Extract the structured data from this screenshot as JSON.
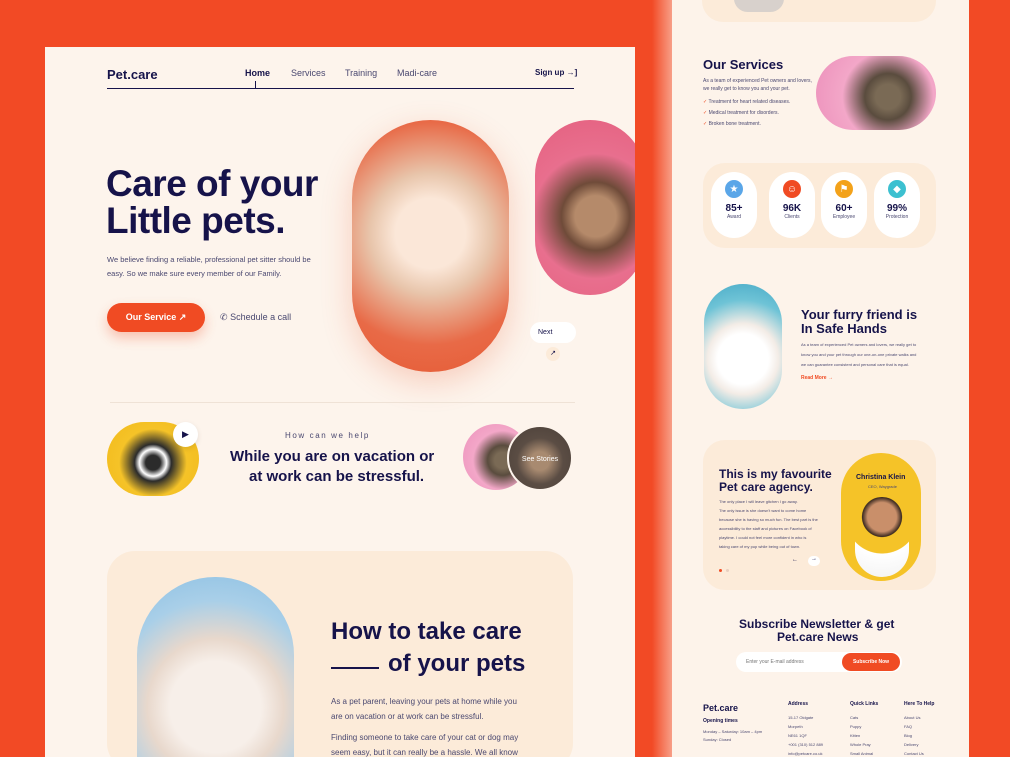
{
  "brand": "Pet.care",
  "nav": {
    "items": [
      "Home",
      "Services",
      "Training",
      "Madi-care"
    ],
    "signup": "Sign up"
  },
  "hero": {
    "title_line1": "Care of your",
    "title_line2": "Little pets.",
    "desc_line1": "We believe finding a reliable, professional pet sitter should be",
    "desc_line2": "easy. So we make sure every member of our Family.",
    "cta": "Our Service",
    "call": "Schedule a call",
    "next": "Next"
  },
  "help": {
    "eyebrow": "How can we help",
    "title_line1": "While you are on vacation or",
    "title_line2": "at work can be stressful.",
    "stories": "See Stories"
  },
  "howto": {
    "title_line1": "How to take care",
    "title_line2": "of your pets",
    "p1_line1": "As a pet parent, leaving your pets at home while you",
    "p1_line2": "are on vacation or at work can be stressful.",
    "p2_line1": "Finding someone to take care of your cat or dog may",
    "p2_line2": "seem easy, but it can really be a hassle. We all know"
  },
  "services": {
    "title": "Our Services",
    "desc_line1": "As a team of experienced Pet owners and lovers,",
    "desc_line2": "we really get to know you and your pet.",
    "items": [
      "Treatment for heart related diseases.",
      "Medical treatment for disorders.",
      "Broken bone treatment."
    ]
  },
  "stats": [
    {
      "value": "85+",
      "label": "Award",
      "color": "#5aa6e8"
    },
    {
      "value": "96K",
      "label": "Clients",
      "color": "#f04b23"
    },
    {
      "value": "60+",
      "label": "Employee",
      "color": "#f3a21a"
    },
    {
      "value": "99%",
      "label": "Protection",
      "color": "#3cc0d0"
    }
  ],
  "safe": {
    "title_line1": "Your furry friend is",
    "title_line2": "In Safe Hands",
    "desc_line1": "As a team of experienced Pet owners and lovers, we really get to",
    "desc_line2": "know you and your pet through our one-on-one private walks and",
    "desc_line3": "we can guarantee consistent and personal care that is equal.",
    "link": "Read More"
  },
  "testimonial": {
    "title_line1": "This is my favourite",
    "title_line2": "Pet care agency.",
    "lines": [
      "The only place I will leave gitchen I go away.",
      "The only issue is she doesn't want to come home",
      "because she is having so much fun. The best part is the",
      "accessibility to the staff and pictures on Facebook of",
      "playtime. I could not feel more confident in who is",
      "taking care of my pup while being out of town."
    ],
    "name": "Christina Klein",
    "role": "CEO, Waygrade",
    "prev": "←",
    "next": "→"
  },
  "newsletter": {
    "title_line1": "Subscribe Newsletter & get",
    "title_line2": "Pet.care News",
    "placeholder": "Enter your E-mail address",
    "button": "Subscribe Now"
  },
  "footer": {
    "brand": "Pet.care",
    "hours_title": "Opening times",
    "hours_line1": "Monday – Saturday: 10am – 4pm",
    "hours_line2": "Sunday: Closed",
    "address_title": "Address",
    "address_lines": [
      "15-17 Oldgate",
      "Morpeth",
      "NE61 1QF",
      "+001 (310) 512 889",
      "info@petcare.co.uk"
    ],
    "quick_title": "Quick Links",
    "quick_links": [
      "Cats",
      "Puppy",
      "Kitten",
      "Whole Pray",
      "Small Animal"
    ],
    "help_title": "Here To Help",
    "help_links": [
      "About Us",
      "FAQ",
      "Blog",
      "Delivery",
      "Contact Us"
    ]
  }
}
